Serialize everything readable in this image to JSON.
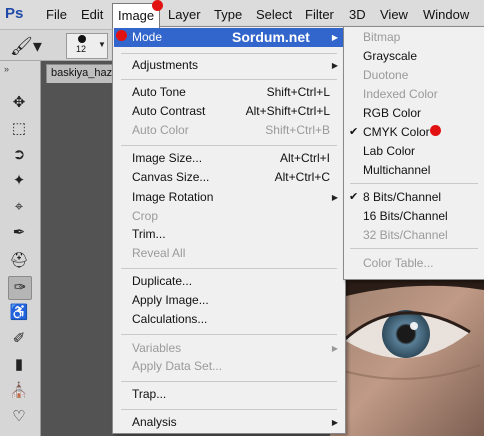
{
  "app": {
    "logo": "Ps"
  },
  "menubar": {
    "items": [
      "File",
      "Edit",
      "Image",
      "Layer",
      "Type",
      "Select",
      "Filter",
      "3D",
      "View",
      "Window"
    ],
    "active": "Image"
  },
  "options": {
    "brush_size": "12"
  },
  "document": {
    "tab_title": "baskiya_haz"
  },
  "watermark": "Sordum.net",
  "image_menu": {
    "items": [
      {
        "label": "Mode",
        "submenu": true,
        "highlighted": true
      },
      {
        "label": "Adjustments",
        "submenu": true
      },
      {
        "label": "Auto Tone",
        "shortcut": "Shift+Ctrl+L"
      },
      {
        "label": "Auto Contrast",
        "shortcut": "Alt+Shift+Ctrl+L"
      },
      {
        "label": "Auto Color",
        "shortcut": "Shift+Ctrl+B",
        "disabled": true
      },
      {
        "label": "Image Size...",
        "shortcut": "Alt+Ctrl+I"
      },
      {
        "label": "Canvas Size...",
        "shortcut": "Alt+Ctrl+C"
      },
      {
        "label": "Image Rotation",
        "submenu": true
      },
      {
        "label": "Crop",
        "disabled": true
      },
      {
        "label": "Trim..."
      },
      {
        "label": "Reveal All",
        "disabled": true
      },
      {
        "label": "Duplicate..."
      },
      {
        "label": "Apply Image..."
      },
      {
        "label": "Calculations..."
      },
      {
        "label": "Variables",
        "submenu": true,
        "disabled": true
      },
      {
        "label": "Apply Data Set...",
        "disabled": true
      },
      {
        "label": "Trap..."
      },
      {
        "label": "Analysis",
        "submenu": true
      }
    ]
  },
  "mode_menu": {
    "items": [
      {
        "label": "Bitmap",
        "disabled": true
      },
      {
        "label": "Grayscale"
      },
      {
        "label": "Duotone",
        "disabled": true
      },
      {
        "label": "Indexed Color",
        "disabled": true
      },
      {
        "label": "RGB Color"
      },
      {
        "label": "CMYK Color",
        "checked": true
      },
      {
        "label": "Lab Color"
      },
      {
        "label": "Multichannel"
      },
      {
        "label": "8 Bits/Channel",
        "checked": true
      },
      {
        "label": "16 Bits/Channel"
      },
      {
        "label": "32 Bits/Channel",
        "disabled": true
      },
      {
        "label": "Color Table...",
        "disabled": true
      }
    ]
  },
  "tools": [
    "move-tool",
    "marquee-tool",
    "lasso-tool",
    "magic-wand-tool",
    "crop-tool",
    "eyedropper-tool",
    "healing-brush-tool",
    "brush-tool",
    "clone-stamp-tool",
    "history-brush-tool",
    "eraser-tool",
    "paint-bucket-tool",
    "blur-tool"
  ],
  "colors": {
    "highlight": "#3366cc",
    "marker": "#e21212",
    "logo": "#1f4aa8"
  }
}
